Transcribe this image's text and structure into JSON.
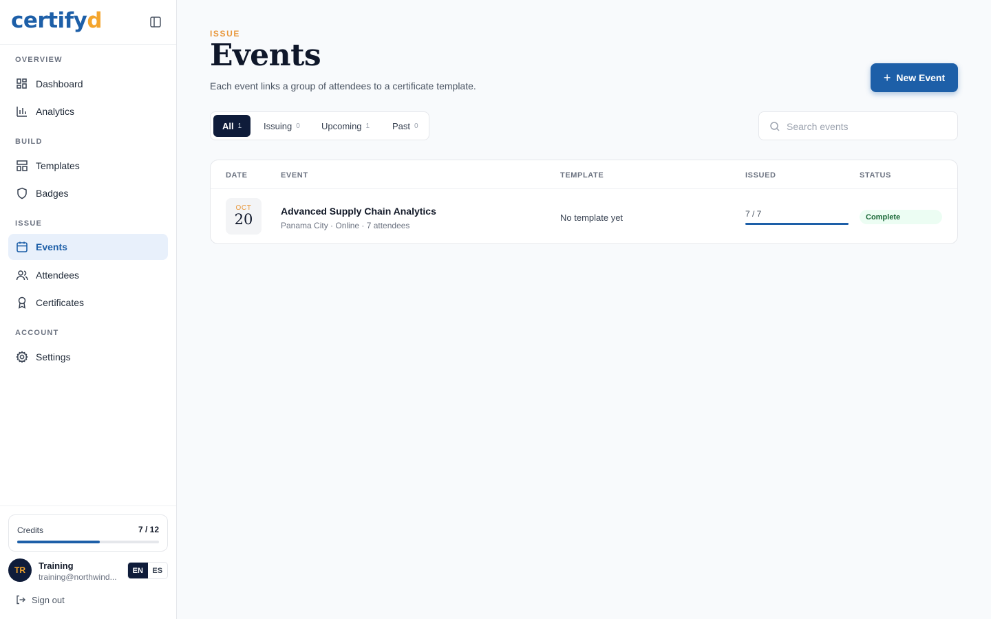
{
  "brand": {
    "logo_main": "certify",
    "logo_accent": "d"
  },
  "sidebar": {
    "sections": [
      {
        "label": "OVERVIEW",
        "items": [
          {
            "label": "Dashboard",
            "icon": "dashboard-icon"
          },
          {
            "label": "Analytics",
            "icon": "bar-chart-icon"
          }
        ]
      },
      {
        "label": "BUILD",
        "items": [
          {
            "label": "Templates",
            "icon": "layout-icon"
          },
          {
            "label": "Badges",
            "icon": "shield-icon"
          }
        ]
      },
      {
        "label": "ISSUE",
        "items": [
          {
            "label": "Events",
            "icon": "calendar-icon",
            "active": true
          },
          {
            "label": "Attendees",
            "icon": "users-icon"
          },
          {
            "label": "Certificates",
            "icon": "award-icon"
          }
        ]
      },
      {
        "label": "ACCOUNT",
        "items": [
          {
            "label": "Settings",
            "icon": "gear-icon"
          }
        ]
      }
    ],
    "credits": {
      "label": "Credits",
      "value": "7 / 12",
      "used": 7,
      "total": 12
    },
    "user": {
      "initials": "TR",
      "name": "Training",
      "email": "training@northwind..."
    },
    "lang": {
      "en": "EN",
      "es": "ES",
      "selected": "EN"
    },
    "sign_out": "Sign out"
  },
  "header": {
    "eyebrow": "ISSUE",
    "title": "Events",
    "subtitle": "Each event links a group of attendees to a certificate template.",
    "new_button": "New Event"
  },
  "tabs": [
    {
      "label": "All",
      "count": "1",
      "active": true
    },
    {
      "label": "Issuing",
      "count": "0"
    },
    {
      "label": "Upcoming",
      "count": "1"
    },
    {
      "label": "Past",
      "count": "0"
    }
  ],
  "search": {
    "placeholder": "Search events",
    "value": ""
  },
  "table": {
    "columns": [
      "DATE",
      "EVENT",
      "TEMPLATE",
      "ISSUED",
      "STATUS"
    ],
    "rows": [
      {
        "month": "OCT",
        "day": "20",
        "event_name": "Advanced Supply Chain Analytics",
        "event_meta": "Panama City · Online · 7 attendees",
        "template": "No template yet",
        "issued_text": "7 / 7",
        "issued_fraction": 1.0,
        "status": "Complete"
      }
    ]
  },
  "colors": {
    "brand_blue": "#1d5fa8",
    "accent_orange": "#f4a52c",
    "navy": "#0f1c3a",
    "success_green": "#166534"
  }
}
